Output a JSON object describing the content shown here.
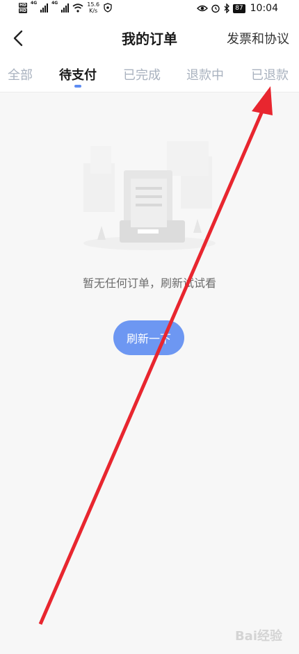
{
  "status_bar": {
    "hd1": "HD",
    "hd2": "HD",
    "net1": "4G",
    "net2": "4G",
    "speed_value": "15.6",
    "speed_unit": "K/s",
    "battery": "87",
    "time": "10:04"
  },
  "header": {
    "title": "我的订单",
    "right_link": "发票和协议"
  },
  "tabs": [
    {
      "label": "全部"
    },
    {
      "label": "待支付"
    },
    {
      "label": "已完成"
    },
    {
      "label": "退款中"
    },
    {
      "label": "已退款"
    }
  ],
  "active_tab": "待支付",
  "empty_state": {
    "message": "暂无任何订单，刷新试试看",
    "button_label": "刷新一下"
  },
  "watermark": "Bai经验",
  "colors": {
    "accent": "#6d97f2",
    "tab_indicator": "#5d8cf2",
    "annotation_arrow": "#e8262f"
  }
}
